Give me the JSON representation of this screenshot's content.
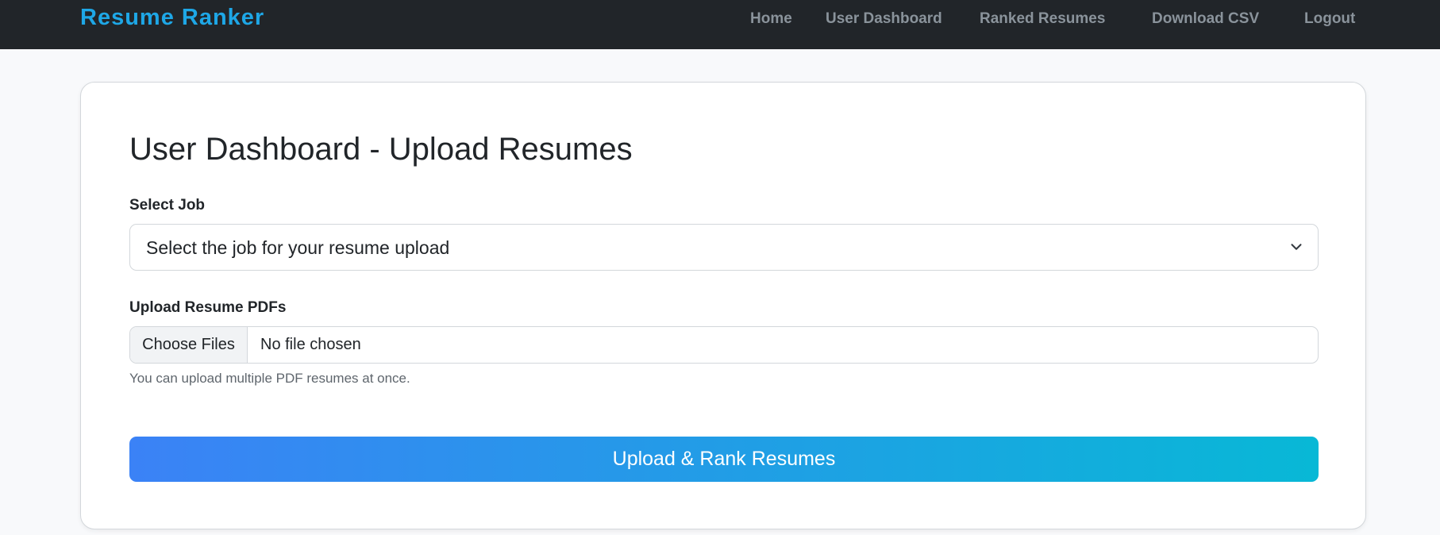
{
  "navbar": {
    "brand": "Resume Ranker",
    "links": [
      "Home",
      "User Dashboard",
      "Ranked Resumes",
      "Download CSV",
      "Logout"
    ]
  },
  "page": {
    "title": "User Dashboard - Upload Resumes"
  },
  "form": {
    "job_label": "Select Job",
    "job_selected": "Select the job for your resume upload",
    "upload_label": "Upload Resume PDFs",
    "file_button": "Choose Files",
    "file_status": "No file chosen",
    "help_text": "You can upload multiple PDF resumes at once.",
    "submit_label": "Upload & Rank Resumes"
  },
  "icons": {
    "select_arrow": "chevron-down-icon"
  },
  "colors": {
    "navbar_bg": "#212529",
    "brand": "#1ea7e6",
    "nav_link": "#8a939b",
    "button_gradient_start": "#3b82f6",
    "button_gradient_end": "#08b8d6"
  }
}
